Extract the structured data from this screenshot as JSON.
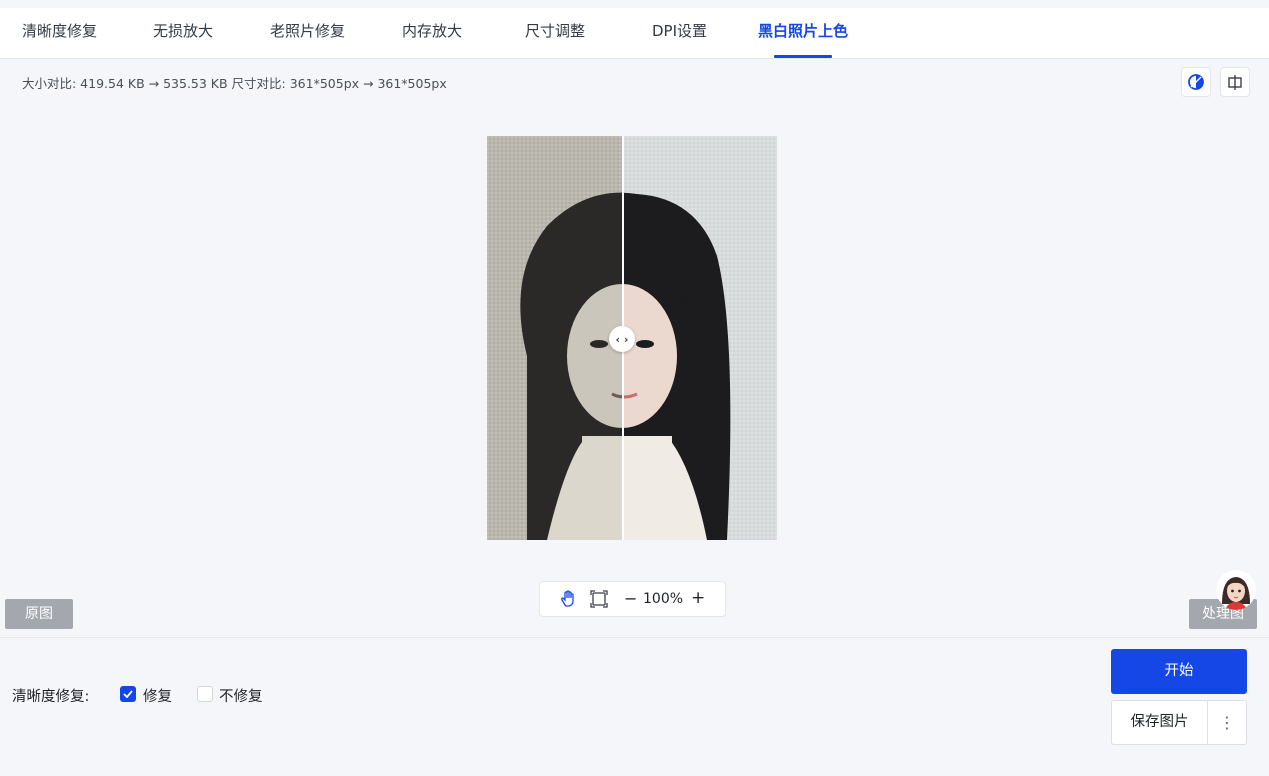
{
  "tabs": [
    {
      "label": "清晰度修复",
      "active": false
    },
    {
      "label": "无损放大",
      "active": false
    },
    {
      "label": "老照片修复",
      "active": false
    },
    {
      "label": "内存放大",
      "active": false
    },
    {
      "label": "尺寸调整",
      "active": false
    },
    {
      "label": "DPI设置",
      "active": false
    },
    {
      "label": "黑白照片上色",
      "active": true
    }
  ],
  "compare_info": "大小对比: 419.54 KB → 535.53 KB   尺寸对比: 361*505px → 361*505px",
  "toolbar_icons": [
    "color-compare-icon",
    "split-view-icon"
  ],
  "zoom": {
    "level": "100%",
    "minus": "−",
    "plus": "+"
  },
  "labels": {
    "original": "原图",
    "processed": "处理图"
  },
  "option": {
    "label": "清晰度修复:",
    "choices": [
      {
        "label": "修复",
        "checked": true
      },
      {
        "label": "不修复",
        "checked": false
      }
    ]
  },
  "actions": {
    "start": "开始",
    "save": "保存图片",
    "more": "⋮"
  },
  "colors": {
    "accent": "#1447e6",
    "label_gray": "#a4a7ad",
    "background": "#f4f6fa"
  }
}
